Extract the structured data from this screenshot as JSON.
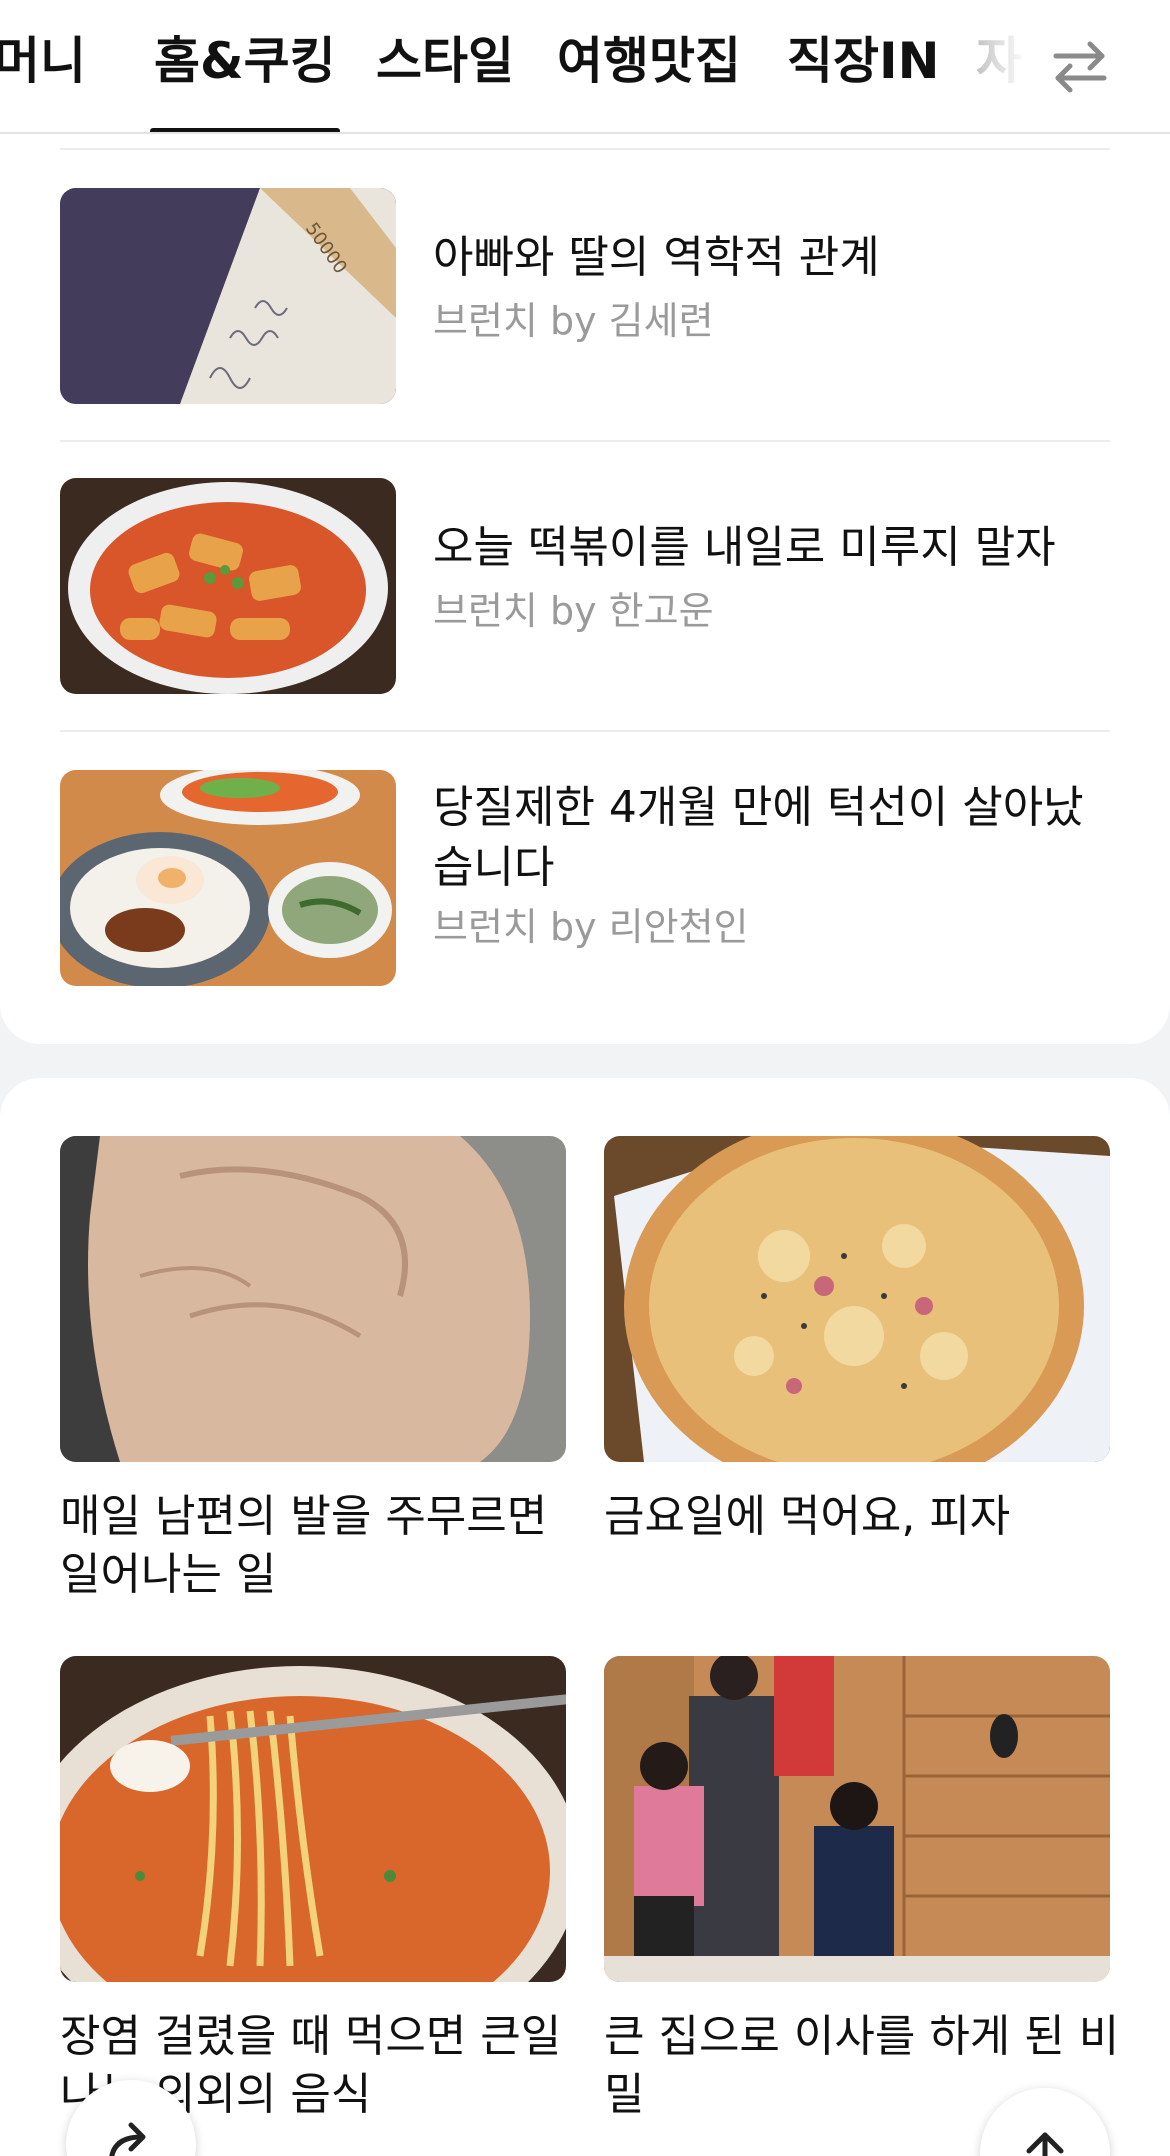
{
  "tabs": {
    "items": [
      {
        "label": "머니"
      },
      {
        "label": "홈&쿠킹"
      },
      {
        "label": "스타일"
      },
      {
        "label": "여행맛집"
      },
      {
        "label": "직장IN"
      },
      {
        "label": "자"
      }
    ],
    "selected": "홈&쿠킹"
  },
  "list": {
    "items": [
      {
        "title": "아빠와 딸의 역학적 관계",
        "author": "브런치 by 김세련"
      },
      {
        "title": "오늘 떡볶이를 내일로 미루지 말자",
        "author": "브런치 by 한고운"
      },
      {
        "title": "당질제한 4개월 만에 턱선이 살아났습니다",
        "author": "브런치 by 리안천인"
      }
    ]
  },
  "grid": {
    "items": [
      {
        "title": "매일 남편의 발을 주무르면 일어나는 일"
      },
      {
        "title": "금요일에 먹어요, 피자"
      },
      {
        "title": "장염 걸렸을 때 먹으면 큰일 나는 의외의 음식"
      },
      {
        "title": "큰 집으로 이사를 하게 된 비밀"
      }
    ]
  },
  "icons": {
    "swap": "swap-arrows-icon",
    "share": "share-icon",
    "scroll_top": "arrow-up-icon"
  },
  "colors": {
    "text": "#111111",
    "meta": "#9a9a9a",
    "background": "#f2f3f5",
    "card": "#ffffff"
  }
}
